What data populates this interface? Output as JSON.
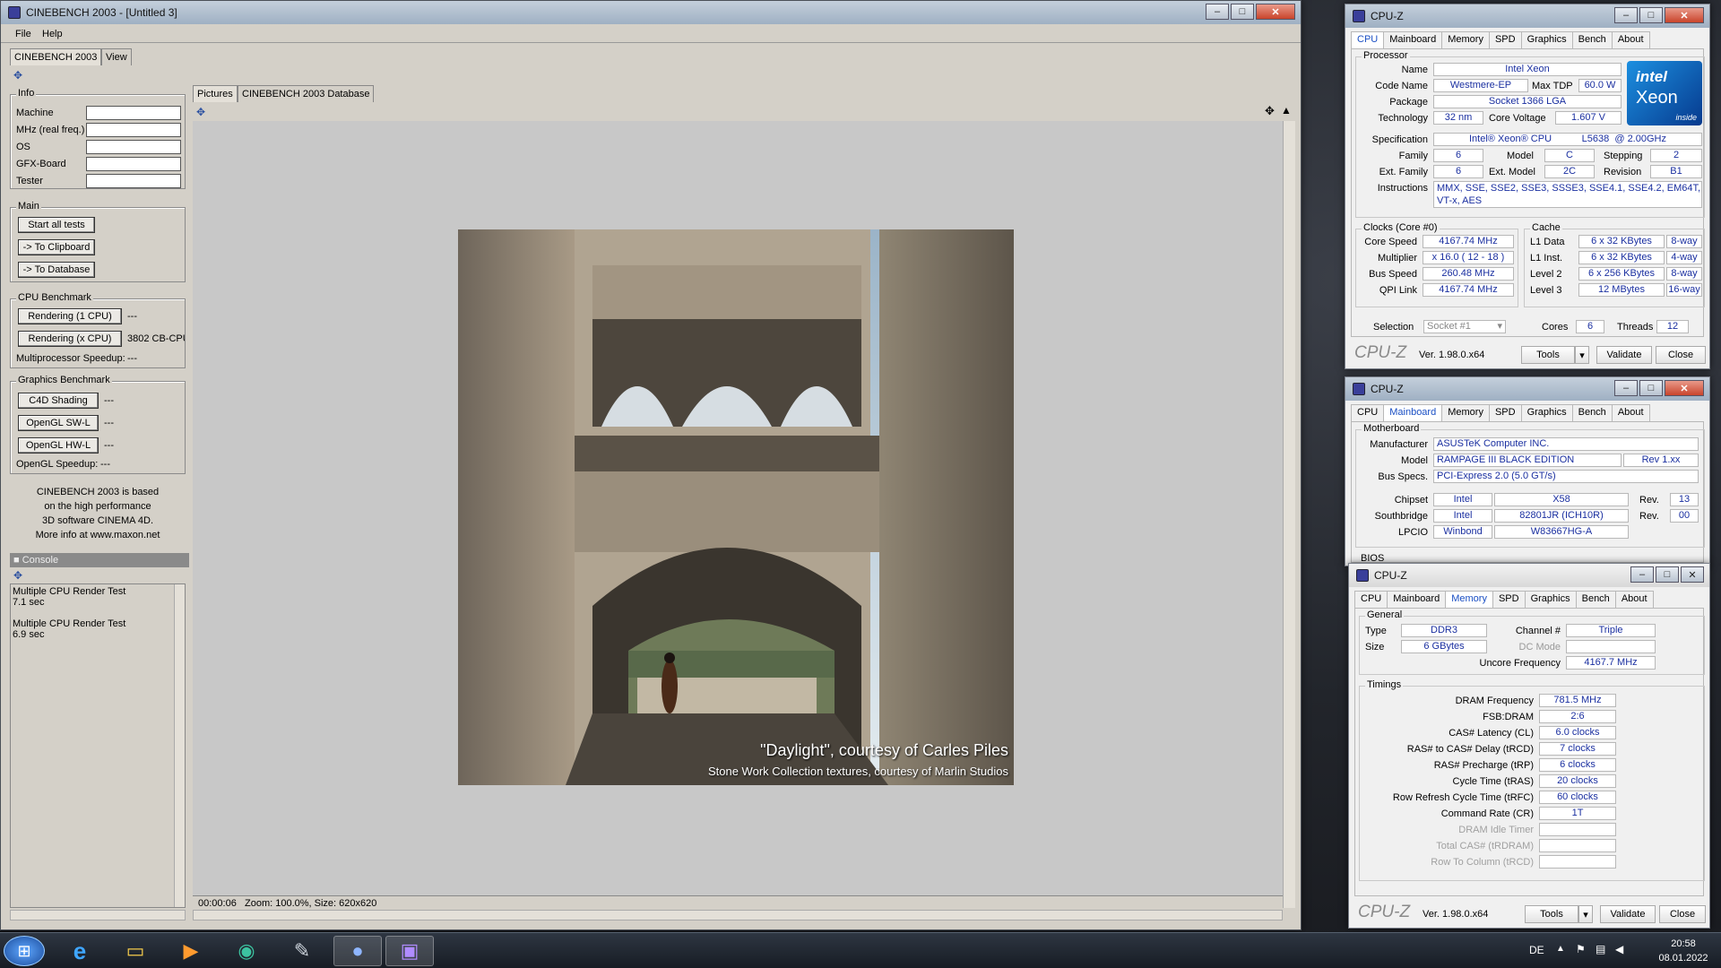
{
  "cinebench": {
    "title": "CINEBENCH 2003 - [Untitled 3]",
    "menu": [
      "File",
      "Help"
    ],
    "tabs": [
      "CINEBENCH 2003",
      "View"
    ],
    "info": {
      "label": "Info",
      "fields": [
        "Machine",
        "MHz (real freq.)",
        "OS",
        "GFX-Board",
        "Tester"
      ]
    },
    "main": {
      "label": "Main",
      "buttons": [
        "Start all tests",
        "-> To Clipboard",
        "-> To Database"
      ]
    },
    "cpu": {
      "label": "CPU Benchmark",
      "btn1": "Rendering (1 CPU)",
      "val1": "---",
      "btn2": "Rendering (x CPU)",
      "val2": "3802 CB-CPU",
      "speedup": "Multiprocessor Speedup:",
      "speedup_val": "---"
    },
    "gfx": {
      "label": "Graphics Benchmark",
      "btn1": "C4D Shading",
      "val1": "---",
      "btn2": "OpenGL SW-L",
      "val2": "---",
      "btn3": "OpenGL HW-L",
      "val3": "---",
      "speedup": "OpenGL Speedup:",
      "speedup_val": "---"
    },
    "about": [
      "CINEBENCH 2003 is based",
      "on the high performance",
      "3D software CINEMA 4D.",
      "More info at www.maxon.net"
    ],
    "console": {
      "label": "Console",
      "lines": [
        "Multiple CPU Render Test",
        "7.1 sec",
        "",
        "Multiple CPU Render Test",
        "6.9 sec"
      ]
    },
    "view_tabs": [
      "Pictures",
      "CINEBENCH 2003 Database"
    ],
    "caption1": "\"Daylight\", courtesy of Carles Piles",
    "caption2": "Stone Work Collection textures, courtesy of Marlin Studios",
    "status": "00:00:06   Zoom: 100.0%, Size: 620x620"
  },
  "cpuz1": {
    "title": "CPU-Z",
    "tabs": [
      "CPU",
      "Mainboard",
      "Memory",
      "SPD",
      "Graphics",
      "Bench",
      "About"
    ],
    "processor": "Processor",
    "name_l": "Name",
    "name": "Intel Xeon",
    "code_l": "Code Name",
    "code": "Westmere-EP",
    "tdp_l": "Max TDP",
    "tdp": "60.0 W",
    "pkg_l": "Package",
    "pkg": "Socket 1366 LGA",
    "tech_l": "Technology",
    "tech": "32 nm",
    "volt_l": "Core Voltage",
    "volt": "1.607 V",
    "spec_l": "Specification",
    "spec": "Intel® Xeon® CPU           L5638  @ 2.00GHz",
    "fam_l": "Family",
    "fam": "6",
    "model_l": "Model",
    "model": "C",
    "step_l": "Stepping",
    "step": "2",
    "efam_l": "Ext. Family",
    "efam": "6",
    "emod_l": "Ext. Model",
    "emod": "2C",
    "rev_l": "Revision",
    "rev": "B1",
    "inst_l": "Instructions",
    "inst": "MMX, SSE, SSE2, SSE3, SSSE3, SSE4.1, SSE4.2, EM64T, VT-x, AES",
    "clocks": "Clocks (Core #0)",
    "cache": "Cache",
    "cs_l": "Core Speed",
    "cs": "4167.74 MHz",
    "mul_l": "Multiplier",
    "mul": "x 16.0 ( 12 - 18 )",
    "bus_l": "Bus Speed",
    "bus": "260.48 MHz",
    "qpi_l": "QPI Link",
    "qpi": "4167.74 MHz",
    "l1d_l": "L1 Data",
    "l1d": "6 x 32 KBytes",
    "l1d_w": "8-way",
    "l1i_l": "L1 Inst.",
    "l1i": "6 x 32 KBytes",
    "l1i_w": "4-way",
    "l2_l": "Level 2",
    "l2": "6 x 256 KBytes",
    "l2_w": "8-way",
    "l3_l": "Level 3",
    "l3": "12 MBytes",
    "l3_w": "16-way",
    "sel_l": "Selection",
    "sel": "Socket #1",
    "cores_l": "Cores",
    "cores": "6",
    "thr_l": "Threads",
    "thr": "12",
    "logo": "CPU-Z",
    "ver": "Ver. 1.98.0.x64",
    "tools": "Tools",
    "validate": "Validate",
    "close": "Close",
    "badge_brand": "intel",
    "badge_name": "Xeon",
    "badge_inside": "inside"
  },
  "cpuz2": {
    "title": "CPU-Z",
    "tabs": [
      "CPU",
      "Mainboard",
      "Memory",
      "SPD",
      "Graphics",
      "Bench",
      "About"
    ],
    "mb": "Motherboard",
    "man_l": "Manufacturer",
    "man": "ASUSTeK Computer INC.",
    "mod_l": "Model",
    "mod": "RAMPAGE III BLACK EDITION",
    "mod_rev": "Rev 1.xx",
    "bs_l": "Bus Specs.",
    "bs": "PCI-Express 2.0 (5.0 GT/s)",
    "chip_l": "Chipset",
    "chip_v": "Intel",
    "chip": "X58",
    "rev_l": "Rev.",
    "chip_rev": "13",
    "sb_l": "Southbridge",
    "sb_v": "Intel",
    "sb": "82801JR (ICH10R)",
    "sb_rev": "00",
    "lpc_l": "LPCIO",
    "lpc_v": "Winbond",
    "lpc": "W83667HG-A",
    "bios": "BIOS"
  },
  "cpuz3": {
    "title": "CPU-Z",
    "tabs": [
      "CPU",
      "Mainboard",
      "Memory",
      "SPD",
      "Graphics",
      "Bench",
      "About"
    ],
    "general": "General",
    "type_l": "Type",
    "type": "DDR3",
    "ch_l": "Channel #",
    "ch": "Triple",
    "size_l": "Size",
    "size": "6 GBytes",
    "dc_l": "DC Mode",
    "dc": "",
    "unc_l": "Uncore Frequency",
    "unc": "4167.7 MHz",
    "timings": "Timings",
    "t": [
      {
        "l": "DRAM Frequency",
        "v": "781.5 MHz",
        "dim": false
      },
      {
        "l": "FSB:DRAM",
        "v": "2:6",
        "dim": false
      },
      {
        "l": "CAS# Latency (CL)",
        "v": "6.0 clocks",
        "dim": false
      },
      {
        "l": "RAS# to CAS# Delay (tRCD)",
        "v": "7 clocks",
        "dim": false
      },
      {
        "l": "RAS# Precharge (tRP)",
        "v": "6 clocks",
        "dim": false
      },
      {
        "l": "Cycle Time (tRAS)",
        "v": "20 clocks",
        "dim": false
      },
      {
        "l": "Row Refresh Cycle Time (tRFC)",
        "v": "60 clocks",
        "dim": false
      },
      {
        "l": "Command Rate (CR)",
        "v": "1T",
        "dim": false
      },
      {
        "l": "DRAM Idle Timer",
        "v": "",
        "dim": true
      },
      {
        "l": "Total CAS# (tRDRAM)",
        "v": "",
        "dim": true
      },
      {
        "l": "Row To Column (tRCD)",
        "v": "",
        "dim": true
      }
    ],
    "logo": "CPU-Z",
    "ver": "Ver. 1.98.0.x64",
    "tools": "Tools",
    "validate": "Validate",
    "close": "Close"
  },
  "taskbar": {
    "lang": "DE",
    "time": "20:58",
    "date": "08.01.2022"
  }
}
